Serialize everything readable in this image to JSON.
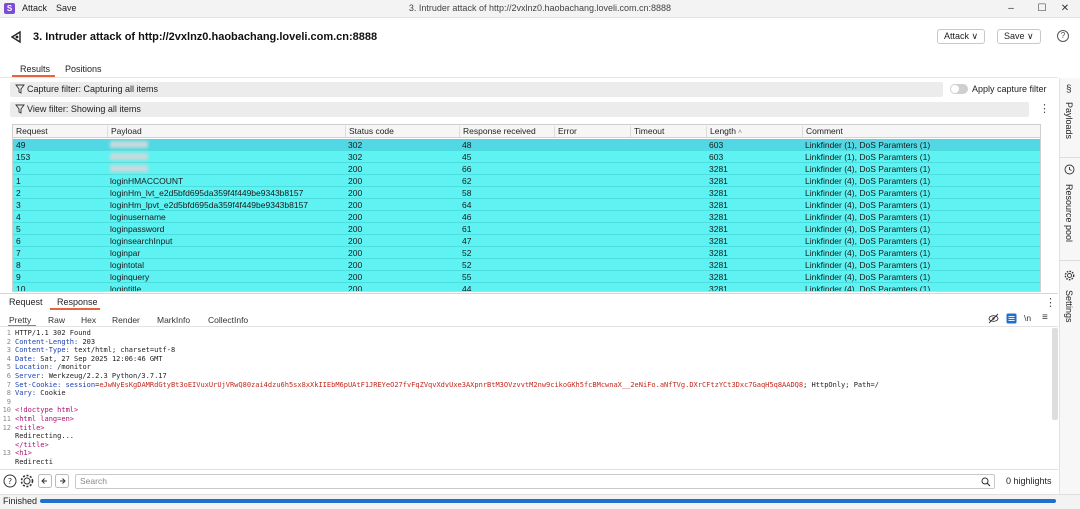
{
  "app": {
    "logo_letter": "S",
    "menu": [
      "Attack",
      "Save"
    ],
    "window_title": "3. Intruder attack of http://2vxlnz0.haobachang.loveli.com.cn:8888",
    "win_controls": [
      "–",
      "☐",
      "✕"
    ]
  },
  "header": {
    "title": "3. Intruder attack of http://2vxlnz0.haobachang.loveli.com.cn:8888",
    "attack_btn": "Attack ∨",
    "save_btn": "Save ∨",
    "help": "?"
  },
  "tabs": [
    "Results",
    "Positions"
  ],
  "filters": {
    "capture": "Capture filter: Capturing all items",
    "apply_capture": "Apply capture filter",
    "view": "View filter: Showing all items"
  },
  "table": {
    "columns": [
      "Request",
      "Payload",
      "Status code",
      "Response received",
      "Error",
      "Timeout",
      "Length",
      "Comment"
    ],
    "rows": [
      {
        "request": "49",
        "payload": "",
        "status": "302",
        "received": "48",
        "length": "603",
        "comment": "Linkfinder (1), DoS Paramters (1)"
      },
      {
        "request": "153",
        "payload": "",
        "status": "302",
        "received": "45",
        "length": "603",
        "comment": "Linkfinder (1), DoS Paramters (1)"
      },
      {
        "request": "0",
        "payload": "",
        "status": "200",
        "received": "66",
        "length": "3281",
        "comment": "Linkfinder (4), DoS Paramters (1)"
      },
      {
        "request": "1",
        "payload": "loginHMACCOUNT",
        "status": "200",
        "received": "62",
        "length": "3281",
        "comment": "Linkfinder (4), DoS Paramters (1)"
      },
      {
        "request": "2",
        "payload": "loginHm_lvt_e2d5bfd695da359f4f449be9343b8157",
        "status": "200",
        "received": "58",
        "length": "3281",
        "comment": "Linkfinder (4), DoS Paramters (1)"
      },
      {
        "request": "3",
        "payload": "loginHm_lpvt_e2d5bfd695da359f4f449be9343b8157",
        "status": "200",
        "received": "64",
        "length": "3281",
        "comment": "Linkfinder (4), DoS Paramters (1)"
      },
      {
        "request": "4",
        "payload": "loginusername",
        "status": "200",
        "received": "46",
        "length": "3281",
        "comment": "Linkfinder (4), DoS Paramters (1)"
      },
      {
        "request": "5",
        "payload": "loginpassword",
        "status": "200",
        "received": "61",
        "length": "3281",
        "comment": "Linkfinder (4), DoS Paramters (1)"
      },
      {
        "request": "6",
        "payload": "loginsearchInput",
        "status": "200",
        "received": "47",
        "length": "3281",
        "comment": "Linkfinder (4), DoS Paramters (1)"
      },
      {
        "request": "7",
        "payload": "loginpar",
        "status": "200",
        "received": "52",
        "length": "3281",
        "comment": "Linkfinder (4), DoS Paramters (1)"
      },
      {
        "request": "8",
        "payload": "logintotal",
        "status": "200",
        "received": "52",
        "length": "3281",
        "comment": "Linkfinder (4), DoS Paramters (1)"
      },
      {
        "request": "9",
        "payload": "loginquery",
        "status": "200",
        "received": "55",
        "length": "3281",
        "comment": "Linkfinder (4), DoS Paramters (1)"
      },
      {
        "request": "10",
        "payload": "logintitle",
        "status": "200",
        "received": "44",
        "length": "3281",
        "comment": "Linkfinder (4), DoS Paramters (1)"
      }
    ]
  },
  "message_tabs": [
    "Request",
    "Response"
  ],
  "view_tabs": [
    "Pretty",
    "Raw",
    "Hex",
    "Render",
    "MarkInfo",
    "CollectInfo"
  ],
  "response_lines": [
    {
      "n": "1",
      "parts": [
        {
          "c": "plain",
          "t": "HTTP/1.1 302 Found"
        }
      ]
    },
    {
      "n": "2",
      "parts": [
        {
          "c": "key",
          "t": "Content-Length: "
        },
        {
          "c": "val",
          "t": "203"
        }
      ]
    },
    {
      "n": "3",
      "parts": [
        {
          "c": "key",
          "t": "Content-Type: "
        },
        {
          "c": "val",
          "t": "text/html; charset=utf-8"
        }
      ]
    },
    {
      "n": "4",
      "parts": [
        {
          "c": "key",
          "t": "Date: "
        },
        {
          "c": "val",
          "t": "Sat, 27 Sep 2025 12:06:46 GMT"
        }
      ]
    },
    {
      "n": "5",
      "parts": [
        {
          "c": "key",
          "t": "Location: "
        },
        {
          "c": "val",
          "t": "/monitor"
        }
      ]
    },
    {
      "n": "6",
      "parts": [
        {
          "c": "key",
          "t": "Server: "
        },
        {
          "c": "val",
          "t": "Werkzeug/2.2.3 Python/3.7.17"
        }
      ]
    },
    {
      "n": "7",
      "parts": [
        {
          "c": "key",
          "t": "Set-Cookie: "
        },
        {
          "c": "key",
          "t": "session"
        },
        {
          "c": "val",
          "t": "="
        },
        {
          "c": "cookie",
          "t": "eJwNyEsKgDAMRdGtyBt3oEIVuxUrUjVRwQ80zai4dzu6h5sx8xXkIIEbM6pUAtF1JREYeO27fvFqZVqvXdvUxe3AXpnrBtM3OVzvvtM2nw9cikoGKh5fcBMcwnaX__2eNiFo.aNfTVg.DXrCFtzYCt3Dxc7GaqH5q8AADQ8"
        },
        {
          "c": "val",
          "t": "; HttpOnly; Path=/"
        }
      ]
    },
    {
      "n": "8",
      "parts": [
        {
          "c": "key",
          "t": "Vary: "
        },
        {
          "c": "val",
          "t": "Cookie"
        }
      ]
    },
    {
      "n": "9",
      "parts": []
    },
    {
      "n": "10",
      "parts": [
        {
          "c": "tag",
          "t": "<!doctype html>"
        }
      ]
    },
    {
      "n": "11",
      "parts": [
        {
          "c": "tag",
          "t": "<html lang=en>"
        }
      ]
    },
    {
      "n": "12",
      "parts": [
        {
          "c": "tag",
          "t": "  <title>"
        }
      ]
    },
    {
      "n": "",
      "parts": [
        {
          "c": "plain",
          "t": "    Redirecting..."
        }
      ]
    },
    {
      "n": "",
      "parts": [
        {
          "c": "tag",
          "t": "  </title>"
        }
      ]
    },
    {
      "n": "13",
      "parts": [
        {
          "c": "tag",
          "t": "  <h1>"
        }
      ]
    },
    {
      "n": "",
      "parts": [
        {
          "c": "plain",
          "t": "    Redirecti"
        }
      ]
    }
  ],
  "toolbar": {
    "newline_label": "\\n"
  },
  "search": {
    "placeholder": "Search",
    "highlights": "0 highlights"
  },
  "status": {
    "text": "Finished",
    "progress": 1.0
  },
  "side_panel": [
    "Payloads",
    "Resource pool",
    "Settings"
  ],
  "colors": {
    "accent": "#e8643a",
    "row_bg": "#5ef2f2",
    "row_selected": "#52d7e4",
    "progress": "#1f6fd1"
  }
}
